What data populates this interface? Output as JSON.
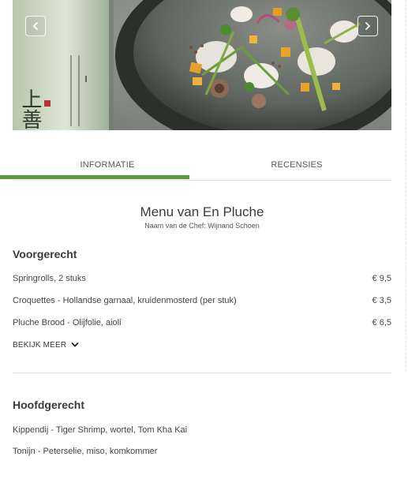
{
  "gallery": {
    "prev_icon": "chevron-left-icon",
    "next_icon": "chevron-right-icon",
    "bottle_lettering": "上善如水"
  },
  "tabs": [
    {
      "label": "INFORMATIE",
      "active": true
    },
    {
      "label": "RECENSIES",
      "active": false
    }
  ],
  "menu": {
    "title": "Menu van En Pluche",
    "chef_line": "Naam van de Chef: Wijnand Schoen",
    "sections": [
      {
        "heading": "Voorgerecht",
        "items": [
          {
            "name": "Springrolls, 2 stuks",
            "price": "€ 9,5"
          },
          {
            "name": "Croquettes - Hollandse garnaal, kruidenmosterd (per stuk)",
            "price": "€ 3,5"
          },
          {
            "name": "Pluche Brood - Olijfolie, aioli",
            "price": "€ 6,5"
          }
        ],
        "see_more": "BEKIJK MEER",
        "see_more_icon": "chevron-down-icon"
      },
      {
        "heading": "Hoofdgerecht",
        "items": [
          {
            "name": "Kippendij - Tiger Shrimp, wortel, Tom Kha Kai",
            "price": ""
          },
          {
            "name": "Tonijn - Peterselie, miso, komkommer",
            "price": ""
          }
        ]
      }
    ]
  },
  "colors": {
    "accent": "#5a9a3e",
    "text": "#333333",
    "divider": "#dedede"
  }
}
